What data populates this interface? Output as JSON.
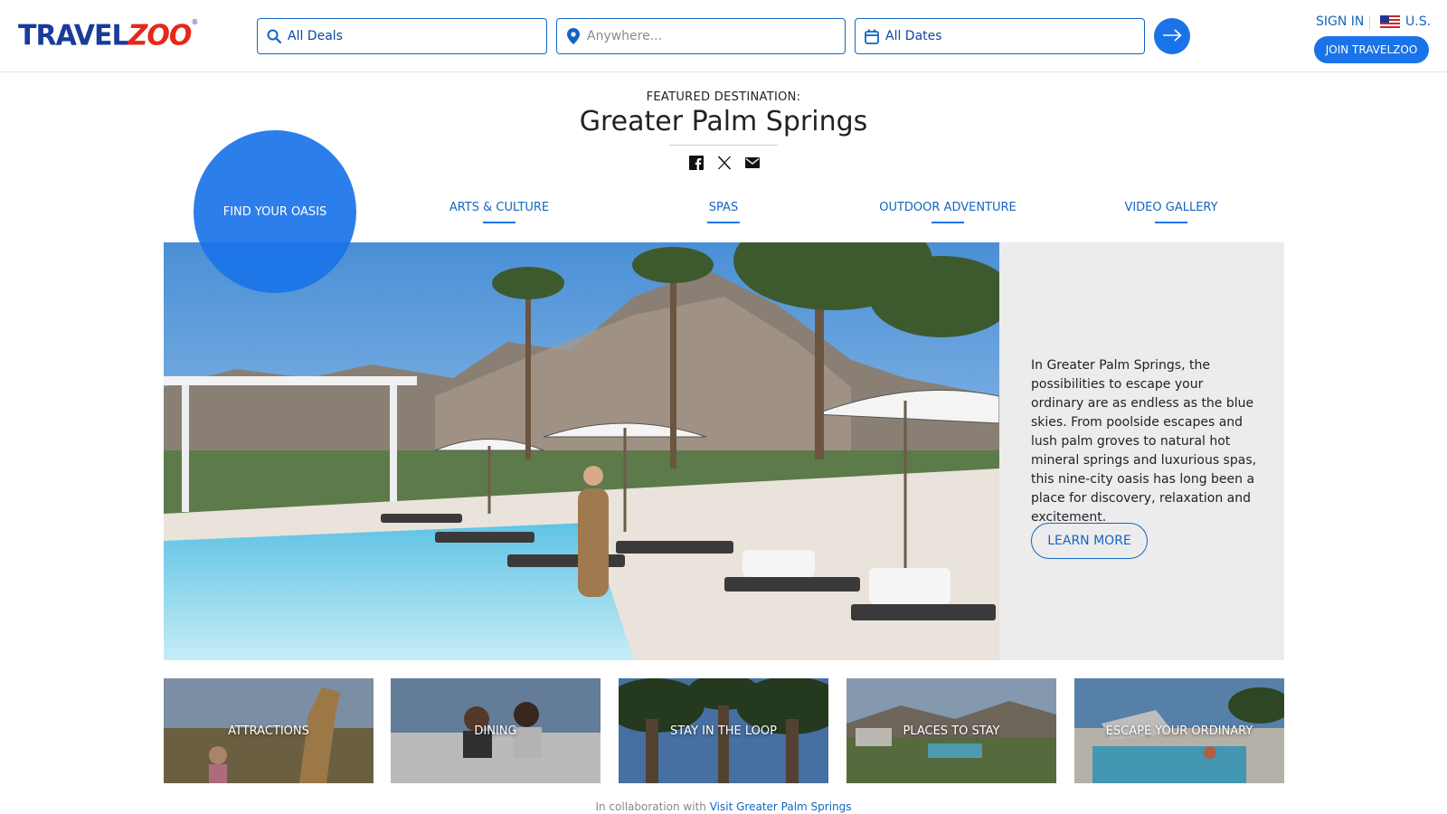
{
  "header": {
    "logo_primary": "TRAVEL",
    "logo_accent": "ZOO",
    "logo_mark": "®",
    "search": {
      "deals_value": "All Deals",
      "where_placeholder": "Anywhere...",
      "dates_value": "All Dates"
    },
    "sign_in": "SIGN IN",
    "region": "U.S.",
    "join": "JOIN TRAVELZOO"
  },
  "feature": {
    "label": "FEATURED DESTINATION:",
    "title": "Greater Palm Springs"
  },
  "tabs": [
    {
      "label": "FIND YOUR OASIS",
      "active": true
    },
    {
      "label": "ARTS & CULTURE"
    },
    {
      "label": "SPAS"
    },
    {
      "label": "OUTDOOR ADVENTURE"
    },
    {
      "label": "VIDEO GALLERY"
    }
  ],
  "hero": {
    "description": "In Greater Palm Springs, the possibilities to escape your ordinary are as endless as the blue skies. From poolside escapes and lush palm groves to natural hot mineral springs and luxurious spas, this nine-city oasis has long been a place for discovery, relaxation and excitement.",
    "cta": "LEARN MORE"
  },
  "tiles": [
    {
      "label": "ATTRACTIONS"
    },
    {
      "label": "DINING"
    },
    {
      "label": "STAY IN THE LOOP"
    },
    {
      "label": "PLACES TO STAY"
    },
    {
      "label": "ESCAPE YOUR ORDINARY"
    }
  ],
  "footer": {
    "collab_prefix": "In collaboration with",
    "collab_link": "Visit Greater Palm Springs"
  },
  "icons": {
    "search": "search-icon",
    "location": "location-pin-icon",
    "calendar": "calendar-icon",
    "go": "arrow-right-icon",
    "facebook": "facebook-icon",
    "x": "x-twitter-icon",
    "email": "email-icon",
    "flag": "us-flag-icon"
  },
  "colors": {
    "brand_blue": "#1a73e8",
    "link_blue": "#1565c0",
    "logo_blue": "#1a3b9c",
    "logo_red": "#e8261a",
    "panel_gray": "#ececec"
  }
}
